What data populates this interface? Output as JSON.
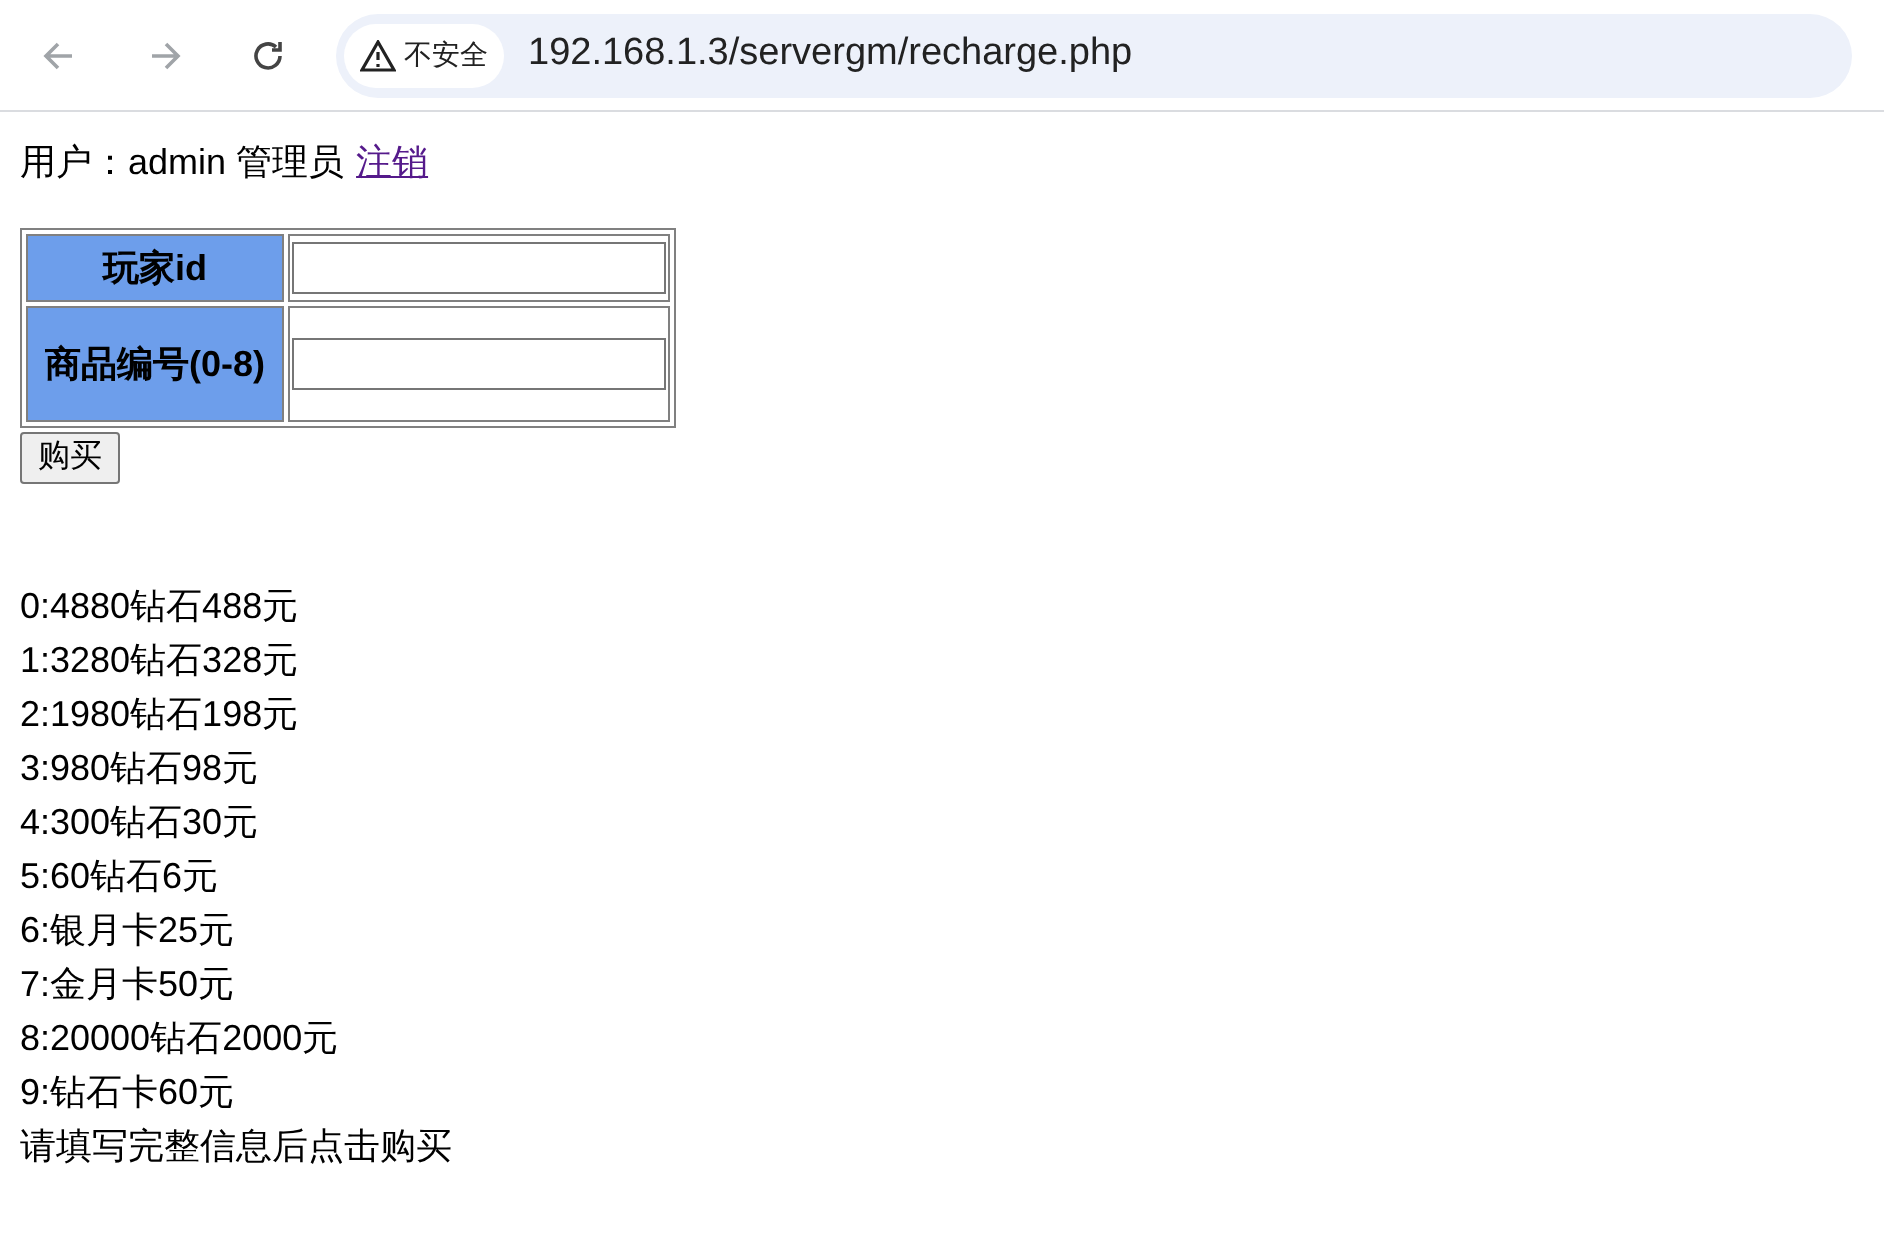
{
  "browser": {
    "security_badge": "不安全",
    "url": "192.168.1.3/servergm/recharge.php"
  },
  "page": {
    "user_label": "用户：admin 管理员",
    "logout_link": "注销",
    "form": {
      "rows": [
        {
          "label": "玩家id"
        },
        {
          "label": "商品编号(0-8)"
        }
      ]
    },
    "buy_button": "购买",
    "items": [
      "0:4880钻石488元",
      "1:3280钻石328元",
      "2:1980钻石198元",
      "3:980钻石98元",
      "4:300钻石30元",
      "5:60钻石6元",
      "6:银月卡25元",
      "7:金月卡50元",
      "8:20000钻石2000元",
      "9:钻石卡60元"
    ],
    "note": "请填写完整信息后点击购买"
  }
}
